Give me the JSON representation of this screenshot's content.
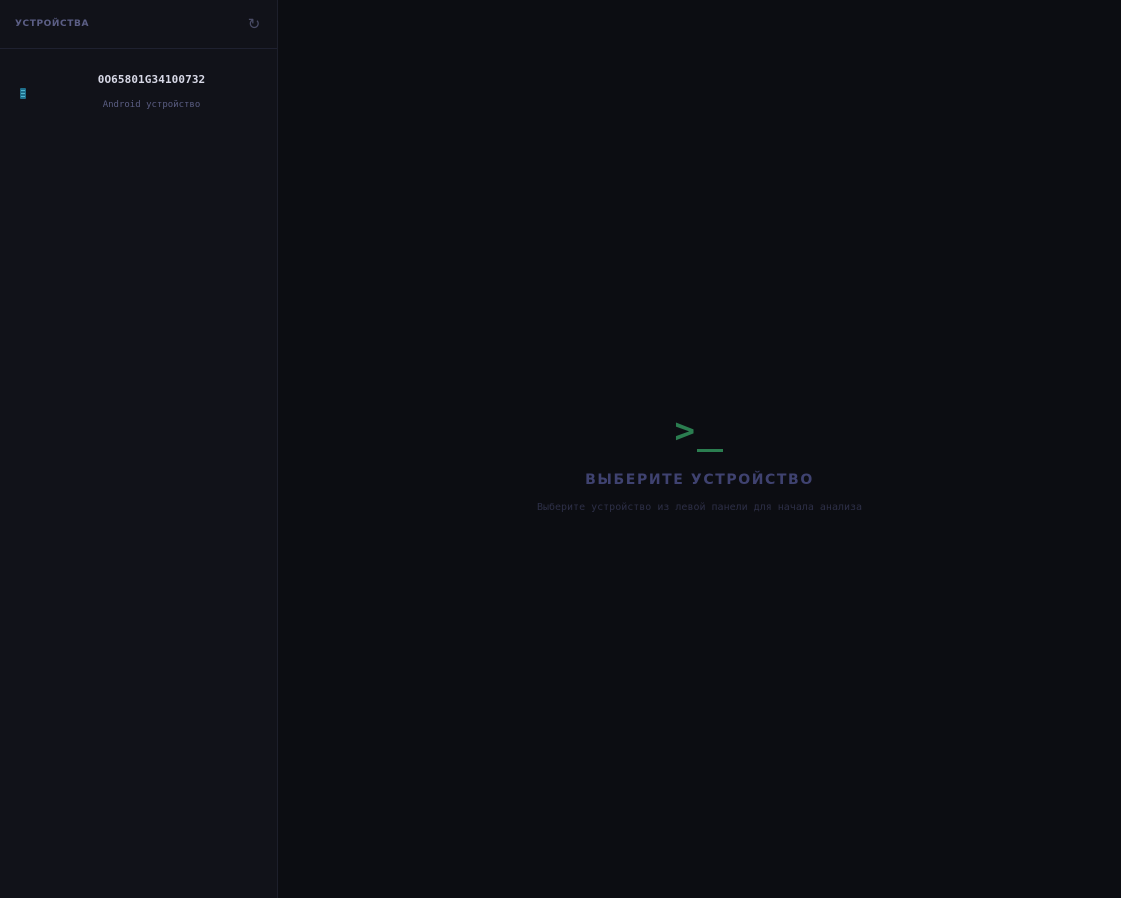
{
  "sidebar": {
    "title": "УСТРОЙСТВА",
    "refresh_glyph": "↻",
    "refresh_icon": "refresh-icon",
    "devices": [
      {
        "serial": "0O65801G34100732",
        "type": "Android устройство",
        "icon": "phone-icon"
      }
    ]
  },
  "main": {
    "empty_icon": "terminal-prompt-icon",
    "empty_icon_glyph": ">",
    "empty_title": "ВЫБЕРИТЕ УСТРОЙСТВО",
    "empty_subtitle": "Выберите устройство из левой панели для начала анализа"
  },
  "colors": {
    "background": "#0c0d12",
    "sidebar_background": "#111219",
    "accent_green": "#2b7d50",
    "device_icon": "#1f6f8b",
    "muted_text": "#5c5f86"
  }
}
